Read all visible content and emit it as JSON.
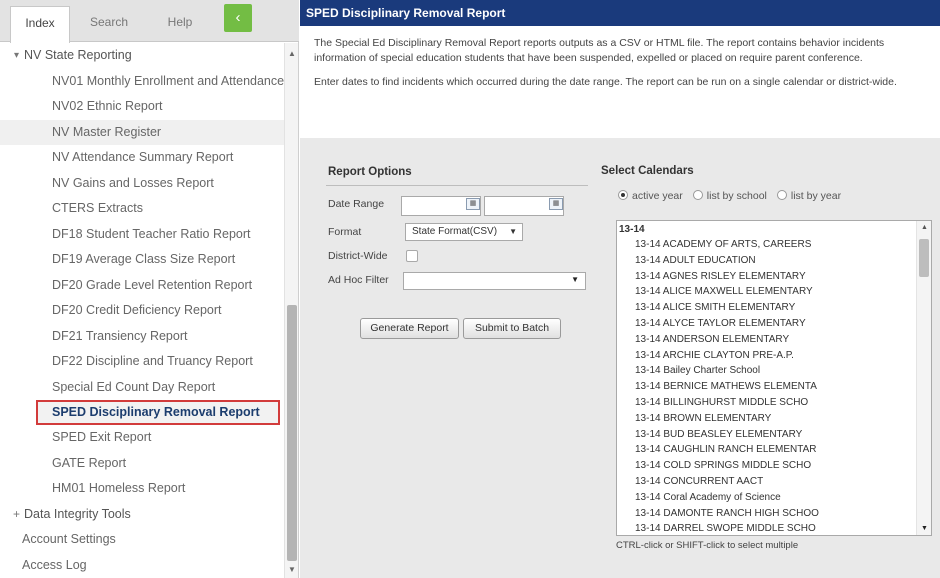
{
  "sidebar": {
    "tabs": [
      "Index",
      "Search",
      "Help"
    ],
    "collapse_glyph": "‹",
    "tree": [
      {
        "label": "NV State Reporting",
        "kind": "folder-open",
        "arrow": "▾"
      },
      {
        "label": "NV01 Monthly Enrollment and Attendance",
        "kind": "child"
      },
      {
        "label": "NV02 Ethnic Report",
        "kind": "child"
      },
      {
        "label": "NV Master Register",
        "kind": "child",
        "highlight": true
      },
      {
        "label": "NV Attendance Summary Report",
        "kind": "child"
      },
      {
        "label": "NV Gains and Losses Report",
        "kind": "child"
      },
      {
        "label": "CTERS Extracts",
        "kind": "child"
      },
      {
        "label": "DF18 Student Teacher Ratio Report",
        "kind": "child"
      },
      {
        "label": "DF19 Average Class Size Report",
        "kind": "child"
      },
      {
        "label": "DF20 Grade Level Retention Report",
        "kind": "child"
      },
      {
        "label": "DF20 Credit Deficiency Report",
        "kind": "child"
      },
      {
        "label": "DF21 Transiency Report",
        "kind": "child"
      },
      {
        "label": "DF22 Discipline and Truancy Report",
        "kind": "child"
      },
      {
        "label": "Special Ed Count Day Report",
        "kind": "child"
      },
      {
        "label": "SPED Disciplinary Removal Report",
        "kind": "selected"
      },
      {
        "label": "SPED Exit Report",
        "kind": "child"
      },
      {
        "label": "GATE Report",
        "kind": "child"
      },
      {
        "label": "HM01 Homeless Report",
        "kind": "child"
      },
      {
        "label": "Data Integrity Tools",
        "kind": "folder-closed",
        "arrow": "+"
      },
      {
        "label": "Account Settings",
        "kind": "top"
      },
      {
        "label": "Access Log",
        "kind": "top"
      }
    ]
  },
  "main": {
    "title": "SPED Disciplinary Removal Report",
    "desc1": "The Special Ed Disciplinary Removal Report reports outputs as a CSV or HTML file. The report contains behavior incidents information of special education students that have been suspended, expelled or placed on require parent conference.",
    "desc2": "Enter dates to find incidents which occurred during the date range. The report can be run on a single calendar or district-wide."
  },
  "options": {
    "title": "Report Options",
    "date_range_label": "Date Range",
    "format_label": "Format",
    "format_value": "State Format(CSV)",
    "district_wide_label": "District-Wide",
    "adhoc_label": "Ad Hoc Filter",
    "generate_label": "Generate Report",
    "batch_label": "Submit to Batch"
  },
  "calendars": {
    "title": "Select Calendars",
    "radio_options": [
      "active year",
      "list by school",
      "list by year"
    ],
    "selected_radio": "active year",
    "group": "13-14",
    "items": [
      "13-14 ACADEMY OF ARTS, CAREERS",
      "13-14 ADULT EDUCATION",
      "13-14 AGNES RISLEY ELEMENTARY",
      "13-14 ALICE MAXWELL ELEMENTARY",
      "13-14 ALICE SMITH ELEMENTARY",
      "13-14 ALYCE TAYLOR ELEMENTARY",
      "13-14 ANDERSON ELEMENTARY",
      "13-14 ARCHIE CLAYTON PRE-A.P.",
      "13-14 Bailey Charter School",
      "13-14 BERNICE MATHEWS ELEMENTA",
      "13-14 BILLINGHURST MIDDLE SCHO",
      "13-14 BROWN ELEMENTARY",
      "13-14 BUD BEASLEY ELEMENTARY",
      "13-14 CAUGHLIN RANCH ELEMENTAR",
      "13-14 COLD SPRINGS MIDDLE SCHO",
      "13-14 CONCURRENT AACT",
      "13-14 Coral Academy of Science",
      "13-14 DAMONTE RANCH HIGH SCHOO",
      "13-14 DARREL SWOPE MIDDLE SCHO"
    ],
    "hint": "CTRL-click or SHIFT-click to select multiple"
  },
  "colors": {
    "header_bg": "#1a3a7c",
    "collapse_button": "#73bd44",
    "selected_border": "#d23b3b"
  }
}
